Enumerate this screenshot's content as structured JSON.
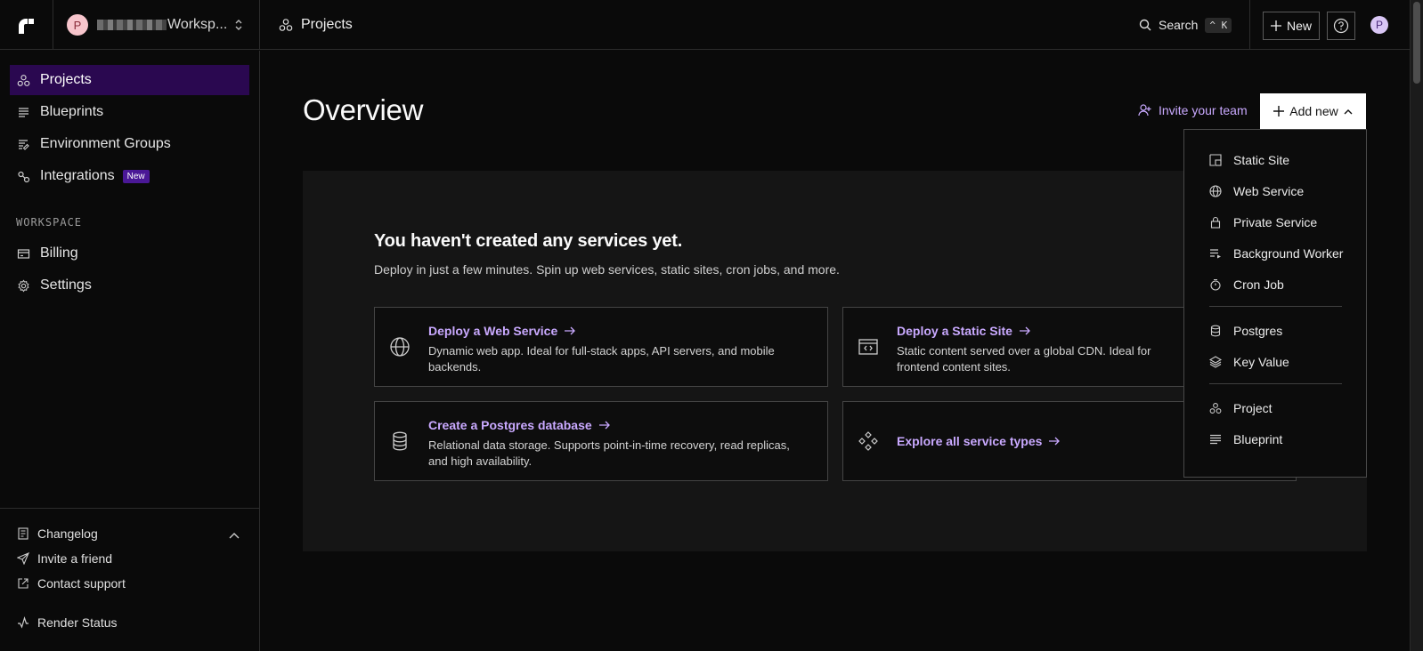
{
  "topbar": {
    "workspace_avatar": "P",
    "workspace_name": "Workspace ▾",
    "workspace_label": "Worksp...",
    "breadcrumb": "Projects",
    "search_label": "Search",
    "search_shortcut": "^ K",
    "new_label": "New",
    "user_avatar": "P"
  },
  "sidebar": {
    "items": [
      {
        "label": "Projects",
        "icon": "projects-icon",
        "active": true
      },
      {
        "label": "Blueprints",
        "icon": "blueprints-icon"
      },
      {
        "label": "Environment Groups",
        "icon": "environment-groups-icon"
      },
      {
        "label": "Integrations",
        "icon": "integrations-icon",
        "badge": "New"
      }
    ],
    "workspace_heading": "WORKSPACE",
    "workspace_items": [
      {
        "label": "Billing",
        "icon": "billing-icon"
      },
      {
        "label": "Settings",
        "icon": "gear-icon"
      }
    ],
    "footer": {
      "changelog": "Changelog",
      "invite_friend": "Invite a friend",
      "contact_support": "Contact support",
      "render_status": "Render Status"
    }
  },
  "main": {
    "title": "Overview",
    "invite_label": "Invite your team",
    "add_new_label": "Add new",
    "empty_title": "You haven't created any services yet.",
    "empty_subtitle": "Deploy in just a few minutes. Spin up web services, static sites, cron jobs, and more.",
    "cards": [
      {
        "title": "Deploy a Web Service",
        "desc": "Dynamic web app. Ideal for full-stack apps, API servers, and mobile backends."
      },
      {
        "title": "Deploy a Static Site",
        "desc": "Static content served over a global CDN. Ideal for frontend content sites."
      },
      {
        "title": "Create a Postgres database",
        "desc": "Relational data storage. Supports point-in-time recovery, read replicas, and high availability."
      },
      {
        "title": "Explore all service types",
        "desc": ""
      }
    ]
  },
  "dropdown": {
    "items": [
      "Static Site",
      "Web Service",
      "Private Service",
      "Background Worker",
      "Cron Job",
      "Postgres",
      "Key Value",
      "Project",
      "Blueprint"
    ]
  },
  "colors": {
    "accent": "#c9a9ff",
    "active_bg": "#2a0850",
    "badge_bg": "#4a1896",
    "background": "#0a0a0a",
    "panel": "#151515"
  }
}
